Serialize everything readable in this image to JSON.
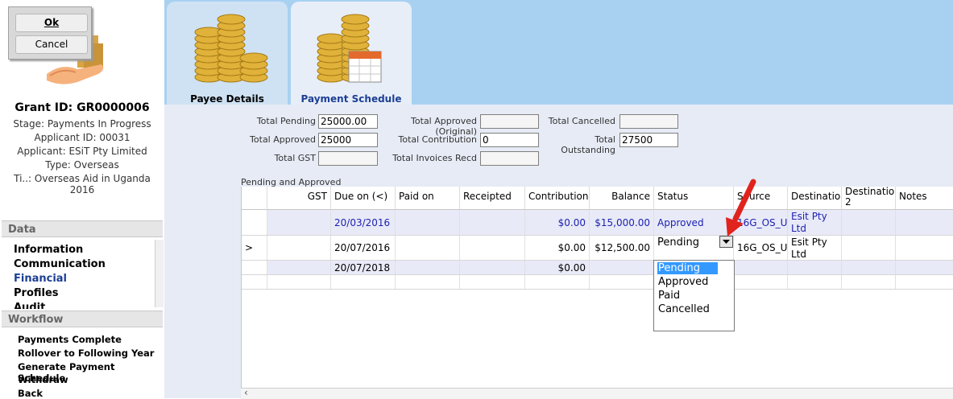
{
  "dialog": {
    "ok_label": "Ok",
    "cancel_label": "Cancel"
  },
  "grant": {
    "title": "Grant ID: GR0000006",
    "stage": "Stage: Payments In Progress",
    "applicant_id": "Applicant ID: 00031",
    "applicant": "Applicant: ESiT Pty Limited",
    "type": "Type: Overseas",
    "title_line": "Ti..: Overseas Aid in Uganda 2016"
  },
  "data_section": {
    "header": "Data",
    "items": [
      "Information",
      "Communication",
      "Financial",
      "Profiles",
      "Audit"
    ]
  },
  "workflow_section": {
    "header": "Workflow",
    "items": [
      "Payments Complete",
      "Rollover to Following Year",
      "Generate Payment Schedule",
      "Withdraw",
      "Back"
    ]
  },
  "tabs": [
    {
      "label": "Payee Details"
    },
    {
      "label": "Payment Schedule"
    }
  ],
  "totals": {
    "total_pending_label": "Total Pending",
    "total_pending": "25000.00",
    "total_approved_label": "Total Approved",
    "total_approved": "25000",
    "total_gst_label": "Total GST",
    "total_gst": "",
    "total_approved_original_label": "Total Approved (Original)",
    "total_approved_original": "",
    "total_contribution_label": "Total Contribution",
    "total_contribution": "0",
    "total_invoices_label": "Total Invoices Recd",
    "total_invoices": "",
    "total_cancelled_label": "Total Cancelled",
    "total_cancelled": "",
    "total_outstanding_label": "Total Outstanding",
    "total_outstanding": "27500"
  },
  "grid": {
    "caption": "Pending and Approved",
    "headers": [
      "GST",
      "Due on (<)",
      "Paid on",
      "Receipted",
      "Contribution",
      "Balance",
      "Status",
      "Source",
      "Destination",
      "Destination 2",
      "Notes"
    ],
    "rows": [
      {
        "marker": "",
        "gst": "",
        "due_on": "20/03/2016",
        "paid_on": "",
        "receipted": "",
        "contribution": "$0.00",
        "balance": "$15,000.00",
        "status": "Approved",
        "source": "16G_OS_U",
        "destination": "Esit Pty Ltd"
      },
      {
        "marker": ">",
        "gst": "",
        "due_on": "20/07/2016",
        "paid_on": "",
        "receipted": "",
        "contribution": "$0.00",
        "balance": "$12,500.00",
        "status": "Pending",
        "source": "16G_OS_U",
        "destination": "Esit Pty Ltd"
      },
      {
        "marker": "",
        "gst": "",
        "due_on": "20/07/2018",
        "paid_on": "",
        "receipted": "",
        "contribution": "$0.00",
        "balance": "",
        "status": "",
        "source": "",
        "destination": ""
      }
    ]
  },
  "status_dropdown": {
    "options": [
      "Pending",
      "Approved",
      "Paid",
      "Cancelled"
    ],
    "selected": "Pending"
  },
  "colors": {
    "header_blue": "#a8d1f1",
    "link_blue": "#1c22b0",
    "selection_blue": "#3399ff",
    "arrow_red": "#e0231c"
  }
}
